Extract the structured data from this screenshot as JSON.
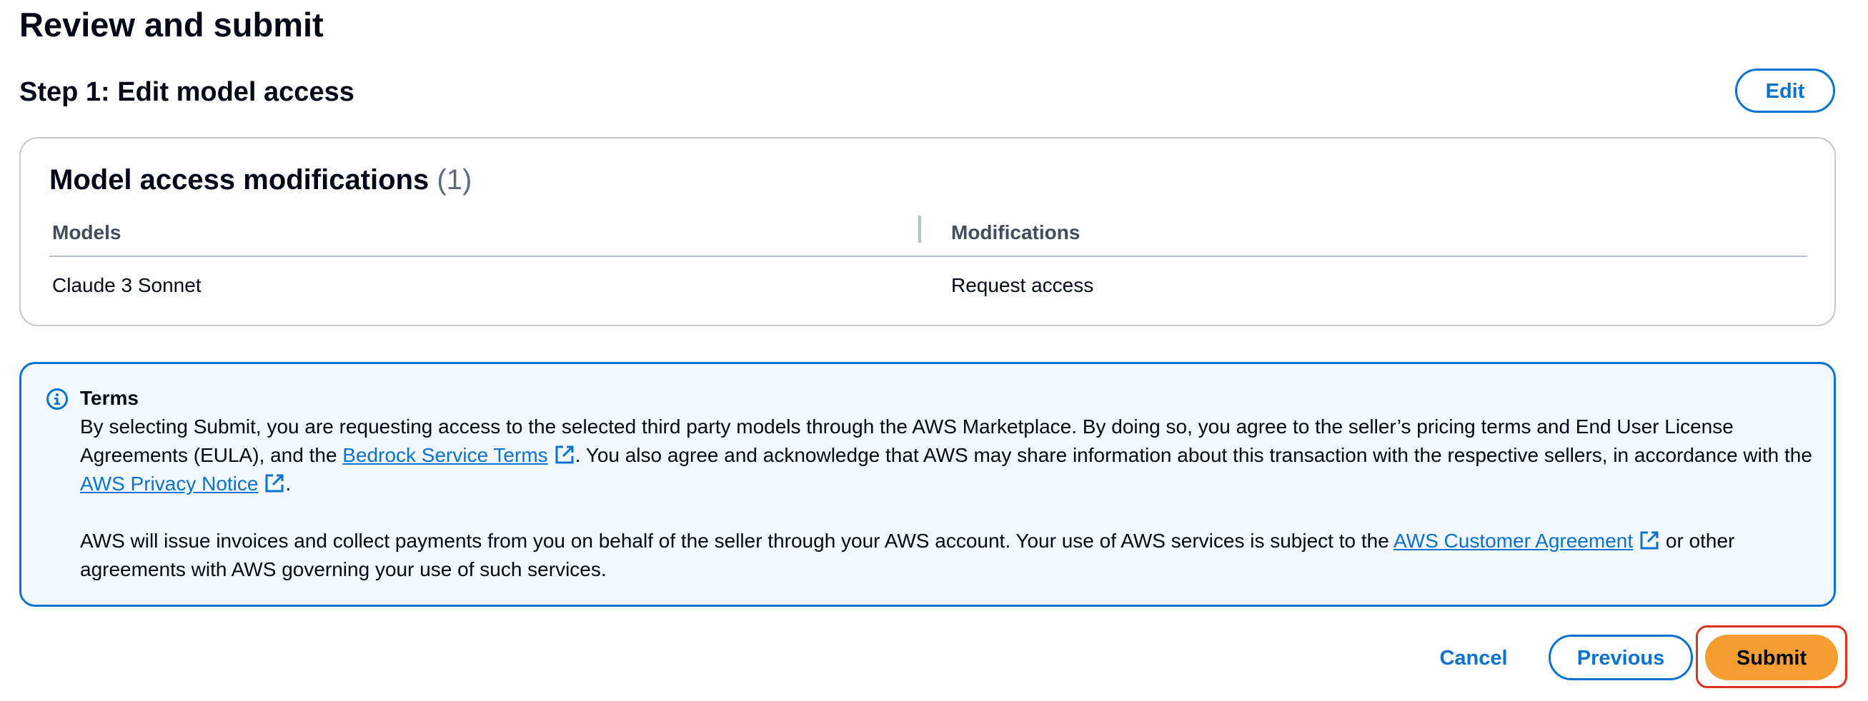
{
  "page": {
    "title": "Review and submit"
  },
  "step": {
    "title": "Step 1: Edit model access",
    "edit_label": "Edit"
  },
  "modifications_card": {
    "title": "Model access modifications",
    "count": "(1)",
    "columns": [
      "Models",
      "Modifications"
    ],
    "rows": [
      {
        "model": "Claude 3 Sonnet",
        "modification": "Request access"
      }
    ]
  },
  "terms": {
    "heading": "Terms",
    "p1_part1": "By selecting Submit, you are requesting access to the selected third party models through the AWS Marketplace. By doing so, you agree to the seller’s pricing terms and End User License Agreements (EULA), and the ",
    "p1_link1": "Bedrock Service Terms",
    "p1_part2": ". You also agree and acknowledge that AWS may share information about this transaction with the respective sellers, in accordance with the ",
    "p1_link2": "AWS Privacy Notice",
    "p1_part3": ".",
    "p2_part1": "AWS will issue invoices and collect payments from you on behalf of the seller through your AWS account. Your use of AWS services is subject to the ",
    "p2_link": "AWS Customer Agreement",
    "p2_part2": " or other agreements with AWS governing your use of such services."
  },
  "actions": {
    "cancel_label": "Cancel",
    "previous_label": "Previous",
    "submit_label": "Submit"
  },
  "colors": {
    "accent": "#0972d3",
    "submit": "#f59d30",
    "alert_background": "#f2f8fd",
    "highlight": "#e0301e"
  },
  "icons": {
    "info": "info-circle-icon",
    "external": "external-link-icon"
  }
}
